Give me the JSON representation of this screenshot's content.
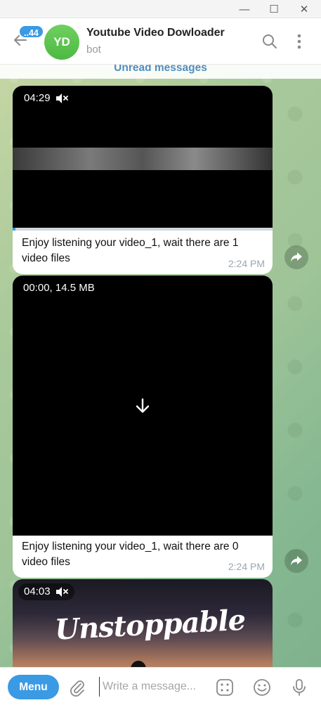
{
  "window": {
    "minimize_glyph": "—",
    "maximize_glyph": "☐",
    "close_glyph": "✕"
  },
  "header": {
    "back_icon": "arrow-left-icon",
    "unread_count": "..44",
    "avatar_initials": "YD",
    "title": "Youtube Video Dowloader",
    "status": "bot"
  },
  "chat": {
    "unread_divider": "Unread messages",
    "messages": [
      {
        "duration": "04:29",
        "caption": "Enjoy listening your video_1, wait there are 1 video files",
        "time": "2:24 PM"
      },
      {
        "duration": "00:00, 14.5 MB",
        "caption": "Enjoy listening your video_1, wait there are 0 video files",
        "time": "2:24 PM"
      },
      {
        "duration": "04:03",
        "overlay_text": "Unstoppable"
      }
    ]
  },
  "composer": {
    "menu_label": "Menu",
    "placeholder": "Write a message..."
  },
  "colors": {
    "accent": "#3a9ae4",
    "avatar": "#4cb942"
  }
}
